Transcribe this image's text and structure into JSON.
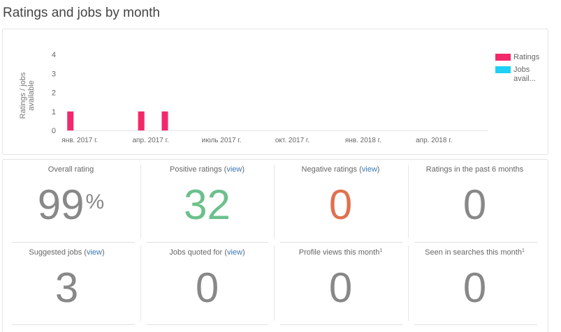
{
  "page_title": "Ratings and jobs by month",
  "chart_data": {
    "type": "bar",
    "title": "",
    "ylabel": "Ratings / jobs available",
    "ylabel_lines": [
      "Ratings / jobs",
      "available"
    ],
    "ylim": [
      0,
      4
    ],
    "yticks": [
      0,
      1,
      2,
      3,
      4
    ],
    "x_ticks": [
      {
        "label": "янв. 2017 г.",
        "month": 0
      },
      {
        "label": "апр. 2017 г.",
        "month": 3
      },
      {
        "label": "июль 2017 г.",
        "month": 6
      },
      {
        "label": "окт. 2017 г.",
        "month": 9
      },
      {
        "label": "янв. 2018 г.",
        "month": 12
      },
      {
        "label": "апр. 2018 г.",
        "month": 15
      }
    ],
    "x_range_months": [
      -0.6,
      17.3
    ],
    "series": [
      {
        "name": "Ratings",
        "color": "#f2286b",
        "points": [
          {
            "month": -0.4,
            "value": 1
          },
          {
            "month": 2.6,
            "value": 1
          },
          {
            "month": 3.6,
            "value": 1
          }
        ]
      },
      {
        "name": "Jobs avail...",
        "color": "#1ed0f5",
        "points": []
      }
    ],
    "legend": "right",
    "legend_labels": [
      [
        "Ratings"
      ],
      [
        "Jobs",
        "avail..."
      ]
    ],
    "grid": false
  },
  "stats": [
    {
      "label": "Overall rating",
      "link": "",
      "sup": "",
      "value": "99",
      "value_sup": "%",
      "color": "#888888"
    },
    {
      "label": "Positive ratings (",
      "link": "view",
      "suffix": ")",
      "sup": "",
      "value": "32",
      "value_sup": "",
      "color": "#6cc08b"
    },
    {
      "label": "Negative ratings (",
      "link": "view",
      "suffix": ")",
      "sup": "",
      "value": "0",
      "value_sup": "",
      "color": "#e0714f"
    },
    {
      "label": "Ratings in the past 6 months",
      "link": "",
      "sup": "",
      "value": "0",
      "value_sup": "",
      "color": "#888888"
    },
    {
      "label": "Suggested jobs (",
      "link": "view",
      "suffix": ")",
      "sup": "",
      "value": "3",
      "value_sup": "",
      "color": "#888888"
    },
    {
      "label": "Jobs quoted for (",
      "link": "view",
      "suffix": ")",
      "sup": "",
      "value": "0",
      "value_sup": "",
      "color": "#888888"
    },
    {
      "label": "Profile views this month",
      "link": "",
      "sup": "1",
      "value": "0",
      "value_sup": "",
      "color": "#888888"
    },
    {
      "label": "Seen in searches this month",
      "link": "",
      "sup": "1",
      "value": "0",
      "value_sup": "",
      "color": "#888888"
    }
  ]
}
